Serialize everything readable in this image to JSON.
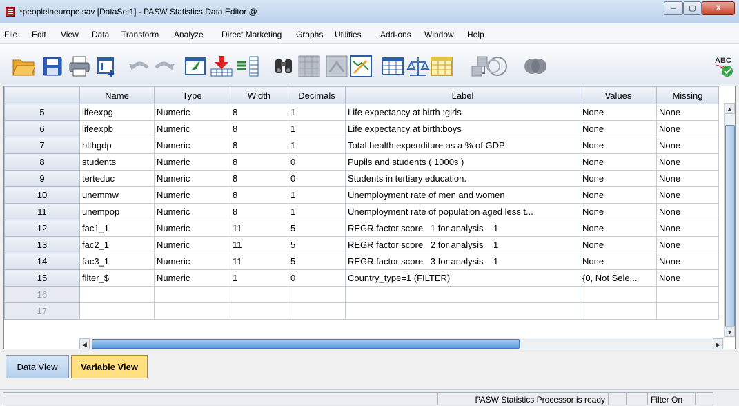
{
  "window": {
    "title": "*peopleineurope.sav [DataSet1] - PASW Statistics Data Editor @",
    "min_label": "–",
    "max_label": "▢",
    "close_label": "X"
  },
  "menu": [
    "File",
    "Edit",
    "View",
    "Data",
    "Transform",
    "Analyze",
    "Direct Marketing",
    "Graphs",
    "Utilities",
    "Add-ons",
    "Window",
    "Help"
  ],
  "toolbar": {
    "icons": [
      "open-folder-icon",
      "save-icon",
      "print-icon",
      "dialog-recall-icon",
      "undo-icon",
      "redo-icon",
      "goto-case-icon",
      "goto-variable-icon",
      "variables-icon",
      "find-icon",
      "insert-cases-icon",
      "insert-variable-icon",
      "split-file-icon",
      "weight-cases-icon",
      "select-cases-icon",
      "value-labels-icon",
      "use-sets-icon",
      "show-all-variables-icon",
      "spell-check-icon"
    ],
    "spell_text": "ABC"
  },
  "columns": [
    "Name",
    "Type",
    "Width",
    "Decimals",
    "Label",
    "Values",
    "Missing"
  ],
  "rows": [
    {
      "n": "5",
      "name": "lifeexpg",
      "type": "Numeric",
      "width": "8",
      "dec": "1",
      "label": " Life expectancy at birth :girls",
      "values": "None",
      "missing": "None"
    },
    {
      "n": "6",
      "name": "lifeexpb",
      "type": "Numeric",
      "width": "8",
      "dec": "1",
      "label": "Life expectancy at birth:boys",
      "values": "None",
      "missing": "None"
    },
    {
      "n": "7",
      "name": "hlthgdp",
      "type": "Numeric",
      "width": "8",
      "dec": "1",
      "label": "Total health expenditure as a % of GDP",
      "values": "None",
      "missing": "None"
    },
    {
      "n": "8",
      "name": "students",
      "type": "Numeric",
      "width": "8",
      "dec": "0",
      "label": "Pupils and students ( 1000s )",
      "values": "None",
      "missing": "None"
    },
    {
      "n": "9",
      "name": "terteduc",
      "type": "Numeric",
      "width": "8",
      "dec": "0",
      "label": "Students in tertiary education.",
      "values": "None",
      "missing": "None"
    },
    {
      "n": "10",
      "name": "unemmw",
      "type": "Numeric",
      "width": "8",
      "dec": "1",
      "label": "Unemployment rate of men and women",
      "values": "None",
      "missing": "None"
    },
    {
      "n": "11",
      "name": "unempop",
      "type": "Numeric",
      "width": "8",
      "dec": "1",
      "label": "Unemployment rate of population aged less t...",
      "values": "None",
      "missing": "None"
    },
    {
      "n": "12",
      "name": "fac1_1",
      "type": "Numeric",
      "width": "11",
      "dec": "5",
      "label": "REGR factor score   1 for analysis    1",
      "values": "None",
      "missing": "None"
    },
    {
      "n": "13",
      "name": "fac2_1",
      "type": "Numeric",
      "width": "11",
      "dec": "5",
      "label": "REGR factor score   2 for analysis    1",
      "values": "None",
      "missing": "None"
    },
    {
      "n": "14",
      "name": "fac3_1",
      "type": "Numeric",
      "width": "11",
      "dec": "5",
      "label": "REGR factor score   3 for analysis    1",
      "values": "None",
      "missing": "None"
    },
    {
      "n": "15",
      "name": "filter_$",
      "type": "Numeric",
      "width": "1",
      "dec": "0",
      "label": "Country_type=1 (FILTER)",
      "values": "{0, Not Sele...",
      "missing": "None"
    },
    {
      "n": "16",
      "name": "",
      "type": "",
      "width": "",
      "dec": "",
      "label": "",
      "values": "",
      "missing": ""
    },
    {
      "n": "17",
      "name": "",
      "type": "",
      "width": "",
      "dec": "",
      "label": "",
      "values": "",
      "missing": ""
    }
  ],
  "tabs": {
    "data_view": "Data View",
    "variable_view": "Variable View"
  },
  "status": {
    "processor": "PASW Statistics Processor is ready",
    "filter": "Filter On"
  }
}
